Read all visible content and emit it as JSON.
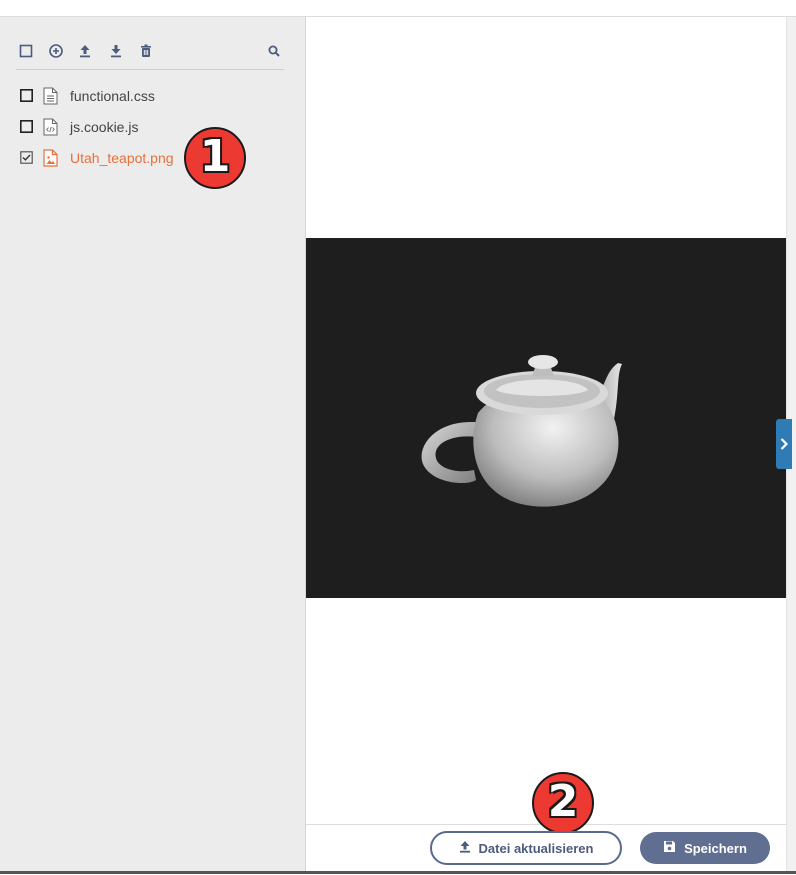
{
  "toolbar": {
    "icons": [
      "select-all-icon",
      "add-icon",
      "upload-icon",
      "download-icon",
      "trash-icon",
      "search-icon"
    ]
  },
  "files": [
    {
      "name": "functional.css",
      "type": "css",
      "checked": false
    },
    {
      "name": "js.cookie.js",
      "type": "js",
      "checked": false
    },
    {
      "name": "Utah_teapot.png",
      "type": "image",
      "checked": true
    }
  ],
  "badges": {
    "one": "1",
    "two": "2"
  },
  "footer": {
    "update_label": "Datei aktualisieren",
    "save_label": "Speichern"
  },
  "colors": {
    "accent": "#e8703a",
    "button_dark": "#5f6e91",
    "toggle": "#2f7cb4",
    "badge": "#ec3a32"
  }
}
